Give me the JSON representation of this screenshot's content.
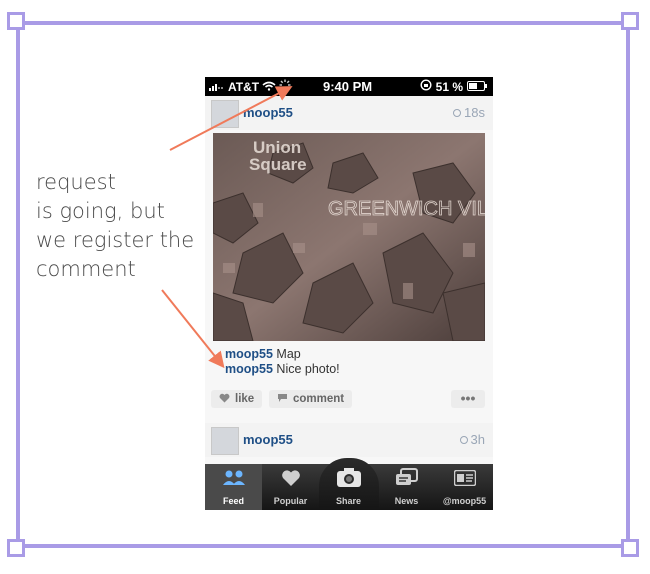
{
  "annotation": {
    "lines": [
      "request",
      "is going, but",
      "we register the",
      "comment"
    ],
    "arrow_color": "#f07a5a",
    "frame_color": "#a99be6"
  },
  "status_bar": {
    "carrier": "AT&T",
    "time": "9:40 PM",
    "battery": "51 %"
  },
  "posts": [
    {
      "username": "moop55",
      "time": "18s",
      "photo_text": [
        "Union",
        "Square",
        "GREENWICH VILLAGE"
      ],
      "comments": [
        {
          "user": "moop55",
          "text": "Map"
        },
        {
          "user": "moop55",
          "text": "Nice photo!"
        }
      ],
      "actions": {
        "like": "like",
        "comment": "comment",
        "more": "•••"
      }
    },
    {
      "username": "moop55",
      "time": "3h"
    }
  ],
  "tabbar": {
    "tabs": [
      {
        "label": "Feed",
        "icon": "feed-icon"
      },
      {
        "label": "Popular",
        "icon": "heart-icon"
      },
      {
        "label": "Share",
        "icon": "camera-icon"
      },
      {
        "label": "News",
        "icon": "news-icon"
      },
      {
        "label": "@moop55",
        "icon": "profile-card-icon"
      }
    ]
  }
}
